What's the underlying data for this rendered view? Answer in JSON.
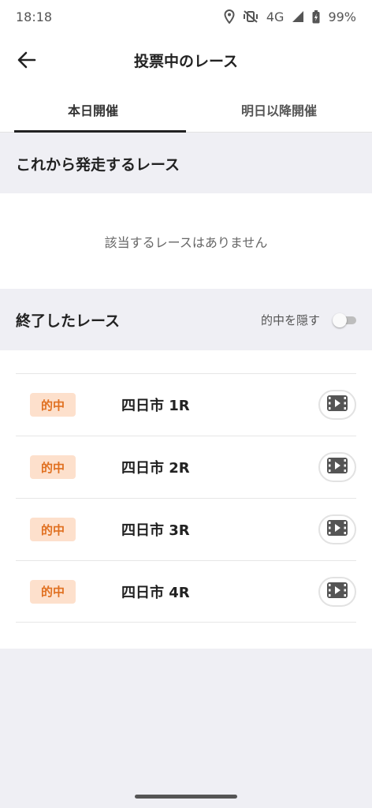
{
  "status_bar": {
    "time": "18:18",
    "network": "4G",
    "battery": "99%"
  },
  "app_bar": {
    "title": "投票中のレース",
    "back_icon": "arrow-left-icon"
  },
  "tabs": [
    {
      "label": "本日開催",
      "active": true
    },
    {
      "label": "明日以降開催",
      "active": false
    }
  ],
  "upcoming": {
    "title": "これから発走するレース",
    "empty_message": "該当するレースはありません"
  },
  "finished": {
    "title": "終了したレース",
    "hide_hits_label": "的中を隠す",
    "hide_hits_on": false,
    "races": [
      {
        "badge": "的中",
        "name": "四日市 1R"
      },
      {
        "badge": "的中",
        "name": "四日市 2R"
      },
      {
        "badge": "的中",
        "name": "四日市 3R"
      },
      {
        "badge": "的中",
        "name": "四日市 4R"
      }
    ]
  },
  "colors": {
    "badge_bg": "#fde0cc",
    "badge_text": "#e07020",
    "section_bg": "#efeff4"
  }
}
